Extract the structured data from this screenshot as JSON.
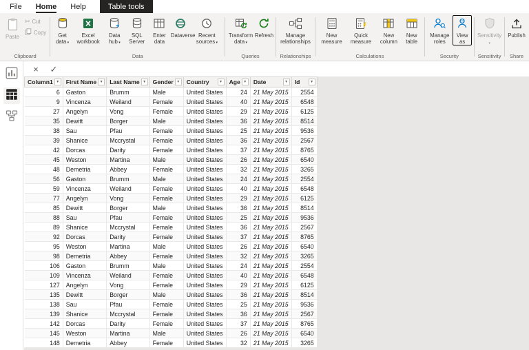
{
  "tabs": {
    "file": "File",
    "home": "Home",
    "help": "Help",
    "table_tools": "Table tools"
  },
  "ribbon": {
    "clipboard": {
      "group_label": "Clipboard",
      "paste": "Paste",
      "cut": "Cut",
      "copy": "Copy"
    },
    "data": {
      "group_label": "Data",
      "get_data": "Get data",
      "excel_workbook": "Excel workbook",
      "data_hub": "Data hub",
      "sql_server": "SQL Server",
      "enter_data": "Enter data",
      "dataverse": "Dataverse",
      "recent_sources": "Recent sources"
    },
    "queries": {
      "group_label": "Queries",
      "transform_data": "Transform data",
      "refresh": "Refresh"
    },
    "relationships": {
      "group_label": "Relationships",
      "manage_relationships": "Manage relationships"
    },
    "calculations": {
      "group_label": "Calculations",
      "new_measure": "New measure",
      "quick_measure": "Quick measure",
      "new_column": "New column",
      "new_table": "New table"
    },
    "security": {
      "group_label": "Security",
      "manage_roles": "Manage roles",
      "view_as": "View as"
    },
    "sensitivity": {
      "group_label": "Sensitivity",
      "sensitivity": "Sensitivity"
    },
    "share": {
      "group_label": "Share",
      "publish": "Publish"
    }
  },
  "colors": {
    "accent_yellow": "#f2c811",
    "excel_green": "#217346",
    "refresh_green": "#107c10",
    "person_blue": "#0b7ac9",
    "contextual_tab_bg": "#252423"
  },
  "table": {
    "columns": [
      "Column1",
      "First Name",
      "Last Name",
      "Gender",
      "Country",
      "Age",
      "Date",
      "Id"
    ],
    "rows": [
      [
        "6",
        "Gaston",
        "Brumm",
        "Male",
        "United States",
        "24",
        "21 May 2015",
        "2554"
      ],
      [
        "9",
        "Vincenza",
        "Weiland",
        "Female",
        "United States",
        "40",
        "21 May 2015",
        "6548"
      ],
      [
        "27",
        "Angelyn",
        "Vong",
        "Female",
        "United States",
        "29",
        "21 May 2015",
        "6125"
      ],
      [
        "35",
        "Dewitt",
        "Borger",
        "Male",
        "United States",
        "36",
        "21 May 2015",
        "8514"
      ],
      [
        "38",
        "Sau",
        "Pfau",
        "Female",
        "United States",
        "25",
        "21 May 2015",
        "9536"
      ],
      [
        "39",
        "Shanice",
        "Mccrystal",
        "Female",
        "United States",
        "36",
        "21 May 2015",
        "2567"
      ],
      [
        "42",
        "Dorcas",
        "Darity",
        "Female",
        "United States",
        "37",
        "21 May 2015",
        "8765"
      ],
      [
        "45",
        "Weston",
        "Martina",
        "Male",
        "United States",
        "26",
        "21 May 2015",
        "6540"
      ],
      [
        "48",
        "Demetria",
        "Abbey",
        "Female",
        "United States",
        "32",
        "21 May 2015",
        "3265"
      ],
      [
        "56",
        "Gaston",
        "Brumm",
        "Male",
        "United States",
        "24",
        "21 May 2015",
        "2554"
      ],
      [
        "59",
        "Vincenza",
        "Weiland",
        "Female",
        "United States",
        "40",
        "21 May 2015",
        "6548"
      ],
      [
        "77",
        "Angelyn",
        "Vong",
        "Female",
        "United States",
        "29",
        "21 May 2015",
        "6125"
      ],
      [
        "85",
        "Dewitt",
        "Borger",
        "Male",
        "United States",
        "36",
        "21 May 2015",
        "8514"
      ],
      [
        "88",
        "Sau",
        "Pfau",
        "Female",
        "United States",
        "25",
        "21 May 2015",
        "9536"
      ],
      [
        "89",
        "Shanice",
        "Mccrystal",
        "Female",
        "United States",
        "36",
        "21 May 2015",
        "2567"
      ],
      [
        "92",
        "Dorcas",
        "Darity",
        "Female",
        "United States",
        "37",
        "21 May 2015",
        "8765"
      ],
      [
        "95",
        "Weston",
        "Martina",
        "Male",
        "United States",
        "26",
        "21 May 2015",
        "6540"
      ],
      [
        "98",
        "Demetria",
        "Abbey",
        "Female",
        "United States",
        "32",
        "21 May 2015",
        "3265"
      ],
      [
        "106",
        "Gaston",
        "Brumm",
        "Male",
        "United States",
        "24",
        "21 May 2015",
        "2554"
      ],
      [
        "109",
        "Vincenza",
        "Weiland",
        "Female",
        "United States",
        "40",
        "21 May 2015",
        "6548"
      ],
      [
        "127",
        "Angelyn",
        "Vong",
        "Female",
        "United States",
        "29",
        "21 May 2015",
        "6125"
      ],
      [
        "135",
        "Dewitt",
        "Borger",
        "Male",
        "United States",
        "36",
        "21 May 2015",
        "8514"
      ],
      [
        "138",
        "Sau",
        "Pfau",
        "Female",
        "United States",
        "25",
        "21 May 2015",
        "9536"
      ],
      [
        "139",
        "Shanice",
        "Mccrystal",
        "Female",
        "United States",
        "36",
        "21 May 2015",
        "2567"
      ],
      [
        "142",
        "Dorcas",
        "Darity",
        "Female",
        "United States",
        "37",
        "21 May 2015",
        "8765"
      ],
      [
        "145",
        "Weston",
        "Martina",
        "Male",
        "United States",
        "26",
        "21 May 2015",
        "6540"
      ],
      [
        "148",
        "Demetria",
        "Abbey",
        "Female",
        "United States",
        "32",
        "21 May 2015",
        "3265"
      ]
    ]
  }
}
